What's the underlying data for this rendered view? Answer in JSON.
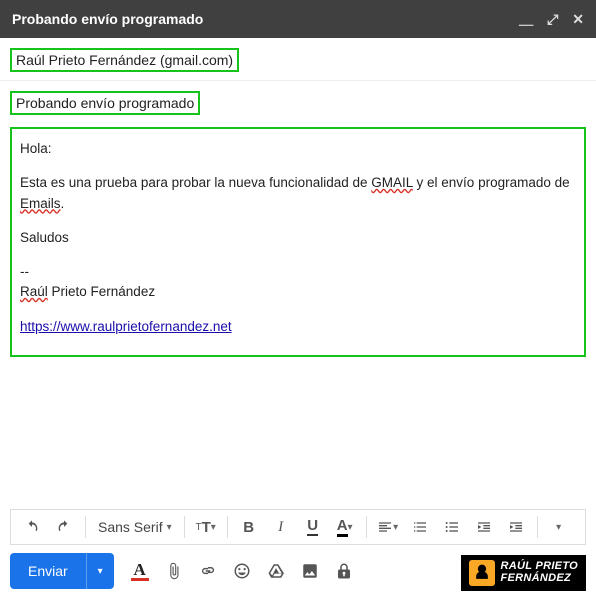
{
  "header": {
    "title": "Probando envío programado"
  },
  "compose": {
    "recipient": "Raúl Prieto Fernández (gmail.com)",
    "subject": "Probando envío programado",
    "body": {
      "greeting": "Hola:",
      "para_pre": "Esta es una prueba para probar la nueva funcionalidad de ",
      "gmail": "GMAIL",
      "para_mid": " y el envío programado de ",
      "emails": "Emails",
      "para_post": ".",
      "regards": "Saludos",
      "sigdash": "--",
      "sig_first": "Raúl",
      "sig_rest": " Prieto Fernández",
      "url": "https://www.raulprietofernandez.net"
    }
  },
  "toolbar": {
    "font": "Sans Serif",
    "bold": "B",
    "italic": "I",
    "underline": "U",
    "textcolor": "A"
  },
  "bottom": {
    "send": "Enviar",
    "textcolor": "A"
  },
  "logo": {
    "line1": "RAÚL PRIETO",
    "line2": "FERNÁNDEZ"
  }
}
